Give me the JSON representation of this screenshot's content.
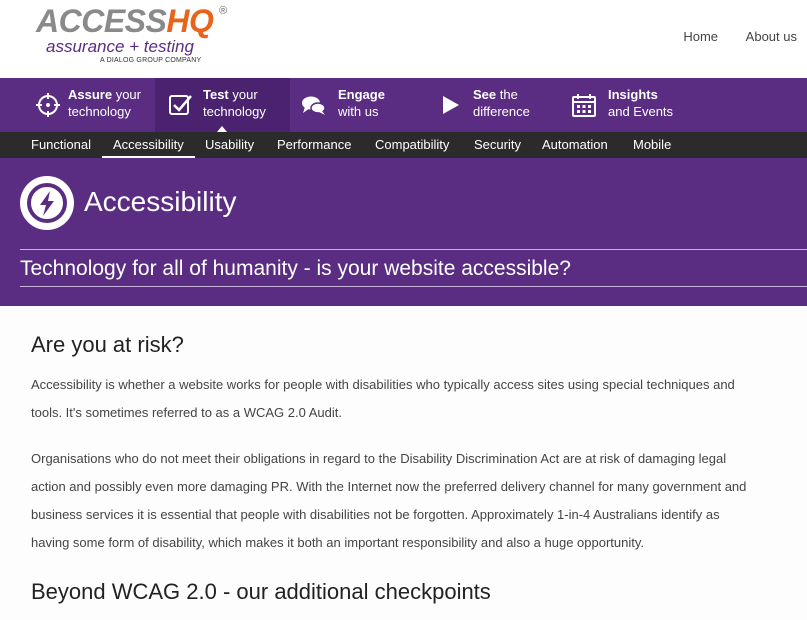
{
  "brand": {
    "logo_access": "ACCESS",
    "logo_hq": "HQ",
    "logo_reg": "®",
    "logo_tagline": "assurance + testing",
    "logo_subline": "A DIALOG GROUP COMPANY"
  },
  "top_links": [
    "Home",
    "About us"
  ],
  "main_nav": [
    {
      "bold": "Assure",
      "rest1": " your",
      "line2": "technology",
      "icon": "crosshair-icon",
      "active": false
    },
    {
      "bold": "Test",
      "rest1": " your",
      "line2": "technology",
      "icon": "checkbox-icon",
      "active": true
    },
    {
      "bold": "Engage",
      "rest1": "",
      "line2": "with us",
      "icon": "chat-bubbles-icon",
      "active": false
    },
    {
      "bold": "See",
      "rest1": " the",
      "line2": "difference",
      "icon": "play-icon",
      "active": false
    },
    {
      "bold": "Insights",
      "rest1": "",
      "line2": "and Events",
      "icon": "calendar-icon",
      "active": false
    }
  ],
  "sub_nav": [
    "Functional",
    "Accessibility",
    "Usability",
    "Performance",
    "Compatibility",
    "Security",
    "Automation",
    "Mobile"
  ],
  "sub_nav_active": "Accessibility",
  "hero": {
    "title": "Accessibility",
    "tagline": "Technology for all of humanity - is your website accessible?",
    "icon": "lightning-bolt-icon"
  },
  "content": {
    "heading1": "Are you at risk?",
    "para1": "Accessibility is whether a website works for people with disabilities who typically access sites using special techniques and tools. It's sometimes referred to as a WCAG 2.0 Audit.",
    "para2": "Organisations who do not meet their obligations in regard to the Disability Discrimination Act are at risk of damaging legal action and possibly even more damaging PR. With the Internet now the preferred delivery channel for many government and business services it is essential that people with disabilities not be forgotten. Approximately 1-in-4 Australians identify as having some form of disability, which makes it both an important responsibility and also a huge opportunity.",
    "heading2": "Beyond WCAG 2.0 - our additional checkpoints"
  },
  "colors": {
    "brand_purple": "#5a2d82",
    "active_purple": "#4a2270",
    "subnav_dark": "#2b2b2b",
    "logo_orange": "#e8641b"
  }
}
